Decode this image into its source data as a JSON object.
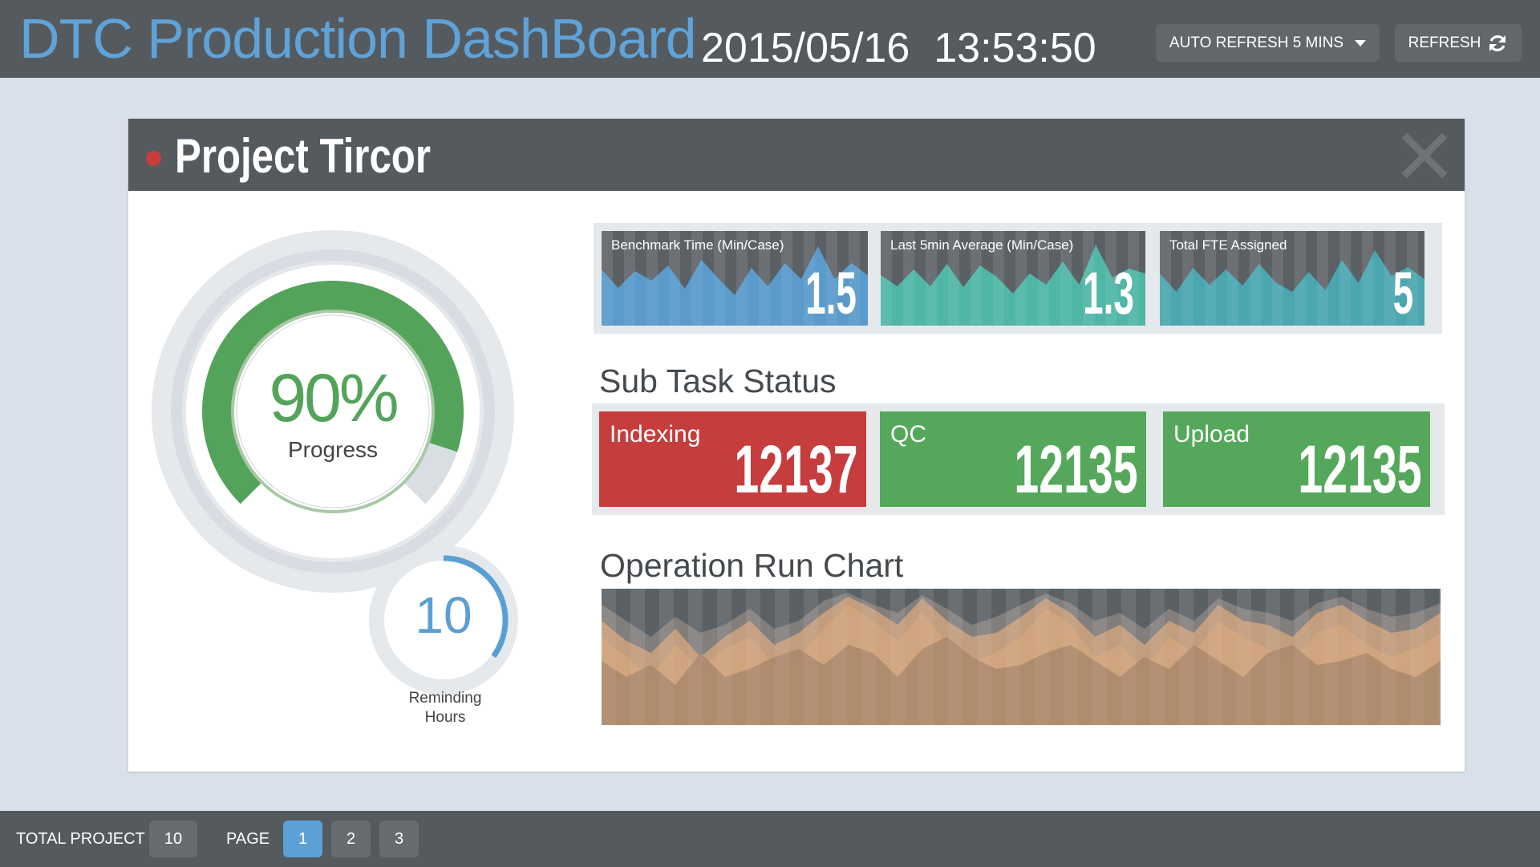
{
  "header": {
    "title": "DTC Production DashBoard",
    "date": "2015/05/16",
    "time": "13:53:50",
    "auto_refresh_label": "AUTO REFRESH 5 MINS",
    "refresh_label": "REFRESH",
    "icons": {
      "dropdown": "chevron-down-icon",
      "refresh": "refresh-icon"
    }
  },
  "project": {
    "name": "Project Tircor",
    "status_color": "#c93c3c",
    "close_icon": "close-icon"
  },
  "progress": {
    "percent_label": "90%",
    "percent": 90,
    "label": "Progress",
    "color": "#54a35a"
  },
  "remaining": {
    "value": "10",
    "label_line1": "Reminding",
    "label_line2": "Hours",
    "fraction": 0.35,
    "color": "#5a9fd4"
  },
  "metrics": [
    {
      "label": "Benchmark Time (Min/Case)",
      "value": "1.5",
      "color": "#5aa2d6"
    },
    {
      "label": "Last 5min Average (Min/Case)",
      "value": "1.3",
      "color": "#4fc0ad"
    },
    {
      "label": "Total FTE Assigned",
      "value": "5",
      "color": "#4aaeb8"
    }
  ],
  "sub_task": {
    "title": "Sub Task Status",
    "tasks": [
      {
        "label": "Indexing",
        "value": "12137",
        "color": "#c63d3d"
      },
      {
        "label": "QC",
        "value": "12135",
        "color": "#55a85b"
      },
      {
        "label": "Upload",
        "value": "12135",
        "color": "#55a85b"
      }
    ]
  },
  "run_chart": {
    "title": "Operation Run Chart"
  },
  "footer": {
    "total_project_label": "TOTAL PROJECT",
    "total_project_value": "10",
    "page_label": "PAGE",
    "pages": [
      "1",
      "2",
      "3"
    ],
    "active_page": "1"
  }
}
